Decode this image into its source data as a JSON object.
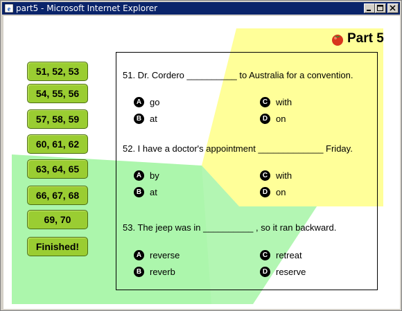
{
  "window": {
    "title": "part5 - Microsoft Internet Explorer"
  },
  "header": {
    "title": "Part 5"
  },
  "nav": {
    "items": [
      "51, 52, 53",
      "54, 55, 56",
      "57, 58, 59",
      "60, 61, 62",
      "63, 64, 65",
      "66, 67, 68",
      "69, 70",
      "Finished!"
    ]
  },
  "questions": [
    {
      "text": "51. Dr. Cordero __________ to Australia for a convention.",
      "options": [
        {
          "letter": "A",
          "text": "go"
        },
        {
          "letter": "B",
          "text": "at"
        },
        {
          "letter": "C",
          "text": "with"
        },
        {
          "letter": "D",
          "text": "on"
        }
      ]
    },
    {
      "text": "52. I have a doctor's appointment _____________ Friday.",
      "options": [
        {
          "letter": "A",
          "text": "by"
        },
        {
          "letter": "B",
          "text": "at"
        },
        {
          "letter": "C",
          "text": "with"
        },
        {
          "letter": "D",
          "text": "on"
        }
      ]
    },
    {
      "text": "53. The jeep was in __________ , so it ran backward.",
      "options": [
        {
          "letter": "A",
          "text": "reverse"
        },
        {
          "letter": "B",
          "text": "reverb"
        },
        {
          "letter": "C",
          "text": "retreat"
        },
        {
          "letter": "D",
          "text": "reserve"
        }
      ]
    }
  ],
  "colors": {
    "titlebar": "#0a246a",
    "nav_button": "#9acd32",
    "yellow_shape": "#ffff99",
    "green_shape": "#90ee90"
  }
}
